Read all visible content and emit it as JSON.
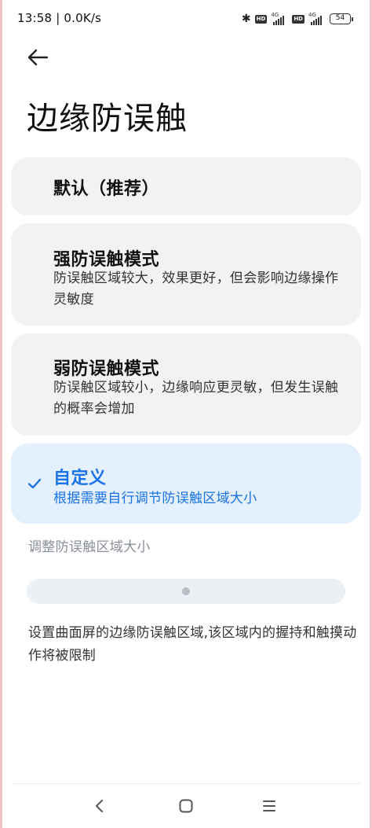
{
  "status_bar": {
    "time_speed": "13:58 | 0.0K/s",
    "hd_badge": "HD",
    "network": "4G",
    "battery": "54"
  },
  "header": {
    "title": "边缘防误触"
  },
  "options": [
    {
      "title": "默认（推荐）",
      "description": "",
      "selected": false
    },
    {
      "title": "强防误触模式",
      "description": "防误触区域较大，效果更好，但会影响边缘操作灵敏度",
      "selected": false
    },
    {
      "title": "弱防误触模式",
      "description": "防误触区域较小，边缘响应更灵敏，但发生误触的概率会增加",
      "selected": false
    },
    {
      "title": "自定义",
      "description": "根据需要自行调节防误触区域大小",
      "selected": true
    }
  ],
  "adjust": {
    "label": "调整防误触区域大小",
    "slider_value": 0.5
  },
  "footnote": "设置曲面屏的边缘防误触区域,该区域内的握持和触摸动作将被限制",
  "colors": {
    "accent": "#1a72e8",
    "selected_bg": "#e4f0fd",
    "card_bg": "#f2f2f2"
  },
  "icons": {
    "back": "arrow-left-icon",
    "check": "check-icon",
    "nav_back": "chevron-left-icon",
    "nav_home": "square-icon",
    "nav_menu": "menu-icon"
  }
}
